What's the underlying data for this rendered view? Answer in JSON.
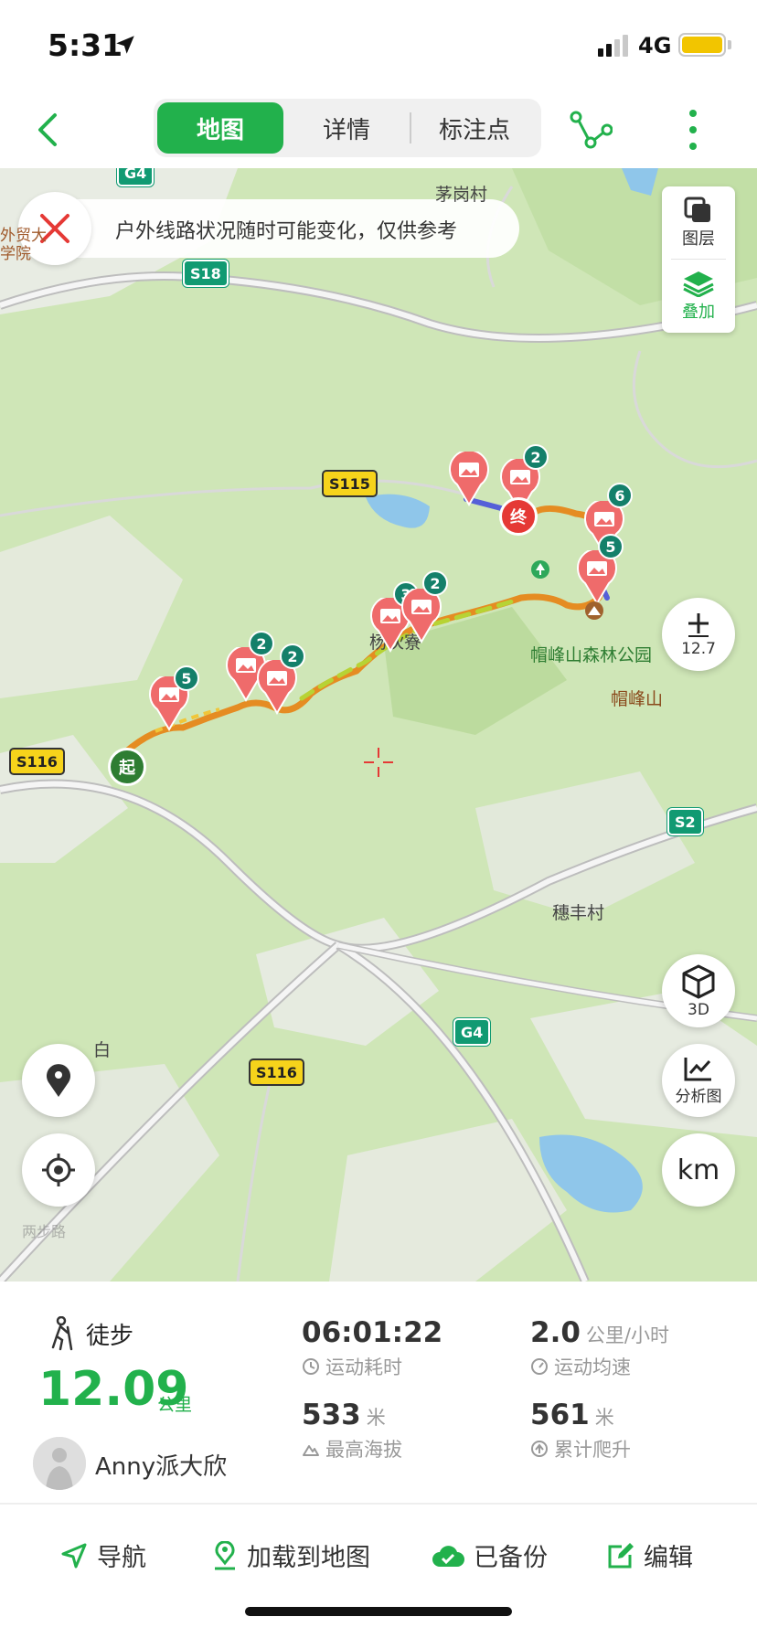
{
  "status_bar": {
    "time": "5:31",
    "network": "4G",
    "battery_color": "#f2c500"
  },
  "header": {
    "tabs": [
      {
        "label": "地图",
        "active": true
      },
      {
        "label": "详情",
        "active": false
      },
      {
        "label": "标注点",
        "active": false
      }
    ],
    "accent": "#22b14c"
  },
  "map": {
    "notice": "户外线路状况随时可能变化，仅供参考",
    "layer_panel": {
      "layers_label": "图层",
      "overlay_label": "叠加"
    },
    "zoom": {
      "value": "12.7"
    },
    "buttons": {
      "three_d": "3D",
      "analysis": "分析图",
      "unit": "km"
    },
    "place_labels": [
      "茅岗村",
      "外贸大学院",
      "杨伙寮",
      "帽峰山森林公园",
      "帽峰山",
      "穗丰村",
      "白"
    ],
    "road_shields": [
      "G4",
      "S18",
      "S115",
      "S116",
      "S2",
      "G4",
      "S116"
    ],
    "markers": {
      "start": "起",
      "end": "终"
    },
    "photo_badges": [
      "5",
      "2",
      "2",
      "3",
      "2",
      "2",
      "6",
      "5"
    ],
    "watermark": "两步路"
  },
  "stats": {
    "activity": "徒步",
    "distance": "12.09",
    "distance_unit": "公里",
    "user_name": "Anny派大欣",
    "duration": {
      "value": "06:01:22",
      "label": "运动耗时"
    },
    "avg_speed": {
      "value": "2.0",
      "unit": "公里/小时",
      "label": "运动均速"
    },
    "max_altitude": {
      "value": "533",
      "unit": "米",
      "label": "最高海拔"
    },
    "total_climb": {
      "value": "561",
      "unit": "米",
      "label": "累计爬升"
    }
  },
  "bottom_actions": {
    "navigate": "导航",
    "load_to_map": "加载到地图",
    "backed_up": "已备份",
    "edit": "编辑"
  }
}
